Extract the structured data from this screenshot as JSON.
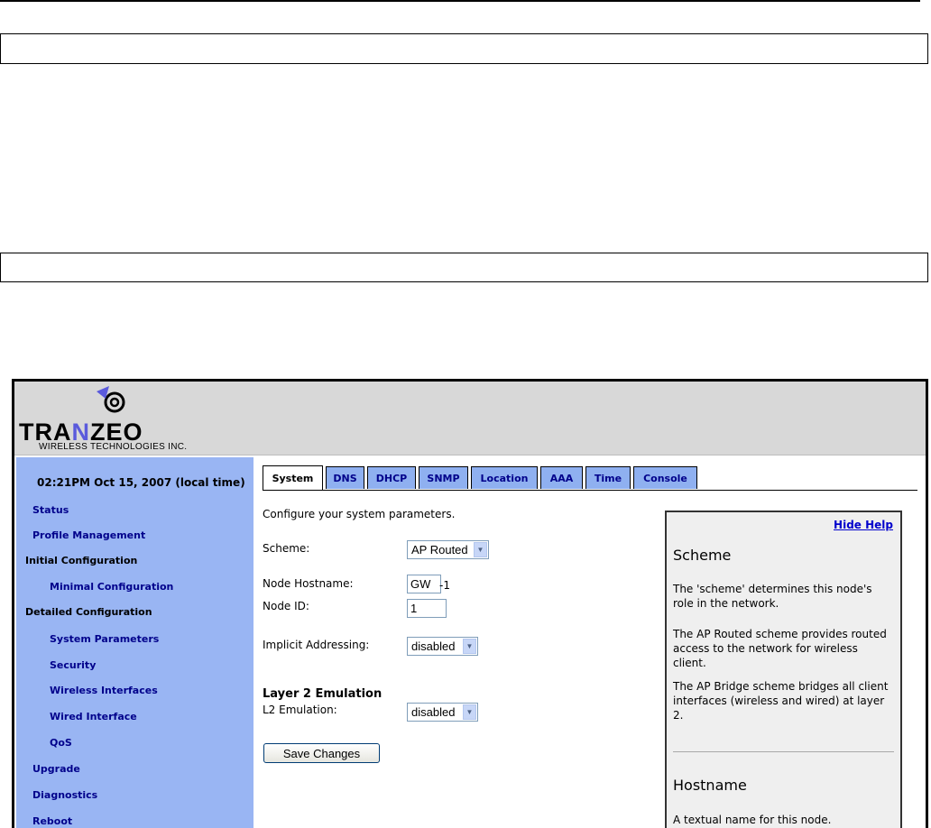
{
  "logo": {
    "word_a": "TRA",
    "word_b": "N",
    "word_c": "ZEO",
    "tagline": "WIRELESS TECHNOLOGIES INC."
  },
  "sidebar": {
    "time": "02:21PM Oct 15, 2007 (local time)",
    "status": "Status",
    "profile": "Profile Management",
    "initial_head": "Initial Configuration",
    "minimal": "Minimal Configuration",
    "detailed_head": "Detailed Configuration",
    "system_params": "System Parameters",
    "security": "Security",
    "wireless": "Wireless Interfaces",
    "wired": "Wired Interface",
    "qos": "QoS",
    "upgrade": "Upgrade",
    "diagnostics": "Diagnostics",
    "reboot": "Reboot"
  },
  "tabs": {
    "system": "System",
    "dns": "DNS",
    "dhcp": "DHCP",
    "snmp": "SNMP",
    "location": "Location",
    "aaa": "AAA",
    "time": "Time",
    "console": "Console"
  },
  "form": {
    "intro": "Configure your system parameters.",
    "scheme_label": "Scheme:",
    "scheme_value": "AP Routed",
    "hostname_label": "Node Hostname:",
    "hostname_value": "GW",
    "hostname_suffix": "-1",
    "nodeid_label": "Node ID:",
    "nodeid_value": "1",
    "implicit_label": "Implicit Addressing:",
    "implicit_value": "disabled",
    "l2_title": "Layer 2 Emulation",
    "l2_label": "L2 Emulation:",
    "l2_value": "disabled",
    "save": "Save Changes"
  },
  "help": {
    "hide": "Hide Help",
    "scheme_title": "Scheme",
    "p1": "The 'scheme' determines this node's role in the network.",
    "p2": "The AP Routed scheme provides routed access to the network for wireless client.",
    "p3": "The AP Bridge scheme bridges all client interfaces (wireless and wired) at layer 2.",
    "hostname_title": "Hostname",
    "p4": "A textual name for this node."
  }
}
